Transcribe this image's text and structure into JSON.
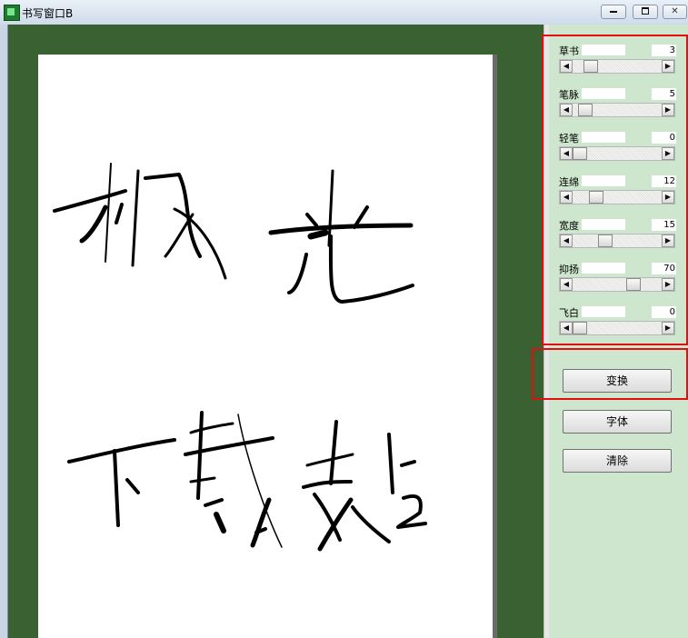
{
  "window": {
    "title": "书写窗口B",
    "controls": {
      "minimize_icon": "minimize-icon",
      "maximize_icon": "maximize-icon",
      "close_icon": "close-icon",
      "close_glyph": "✕"
    }
  },
  "panel": {
    "sliders": [
      {
        "label": "草书",
        "value": "3",
        "level": 0.14
      },
      {
        "label": "笔脉",
        "value": "5",
        "level": 0.07
      },
      {
        "label": "轻笔",
        "value": "0",
        "level": 0.0
      },
      {
        "label": "连绵",
        "value": "12",
        "level": 0.22
      },
      {
        "label": "宽度",
        "value": "15",
        "level": 0.33
      },
      {
        "label": "抑扬",
        "value": "70",
        "level": 0.7
      },
      {
        "label": "飞白",
        "value": "0",
        "level": 0.0
      }
    ],
    "scroll_left_glyph": "◀",
    "scroll_right_glyph": "▶",
    "buttons": {
      "transform": "变换",
      "font": "字体",
      "clear": "清除"
    }
  },
  "colors": {
    "canvas_bg": "#3a6132",
    "panel_bg": "#cde6cd",
    "highlight": "#e01010"
  },
  "canvas": {
    "handwriting_top": "极光",
    "handwriting_bottom": "下载站"
  }
}
